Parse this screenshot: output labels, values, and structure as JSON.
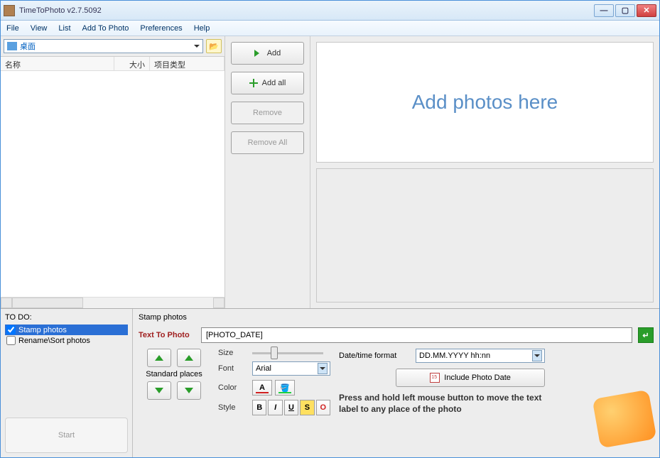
{
  "window": {
    "title": "TimeToPhoto v2.7.5092"
  },
  "menu": {
    "file": "File",
    "view": "View",
    "list": "List",
    "add_to_photo": "Add To Photo",
    "preferences": "Preferences",
    "help": "Help"
  },
  "path": {
    "value": "桌面"
  },
  "columns": {
    "name": "名称",
    "size": "大小",
    "type": "项目类型"
  },
  "actions": {
    "add": "Add",
    "add_all": "Add all",
    "remove": "Remove",
    "remove_all": "Remove All"
  },
  "drop": {
    "hint": "Add photos here"
  },
  "todo": {
    "title": "TO DO:",
    "stamp": "Stamp photos",
    "rename": "Rename\\Sort photos",
    "start": "Start"
  },
  "stamp": {
    "title": "Stamp photos",
    "text_to_photo_label": "Text To Photo",
    "text_value": "[PHOTO_DATE]",
    "standard_places": "Standard places",
    "size": "Size",
    "font": "Font",
    "font_value": "Arial",
    "color": "Color",
    "style": "Style",
    "bold": "B",
    "italic": "I",
    "underline": "U",
    "strike": "S",
    "outline": "O"
  },
  "datetime": {
    "label": "Date/time format",
    "value": "DD.MM.YYYY hh:nn",
    "include": "Include Photo Date",
    "hint": "Press and hold left mouse button to move the text label to any place of the photo"
  }
}
